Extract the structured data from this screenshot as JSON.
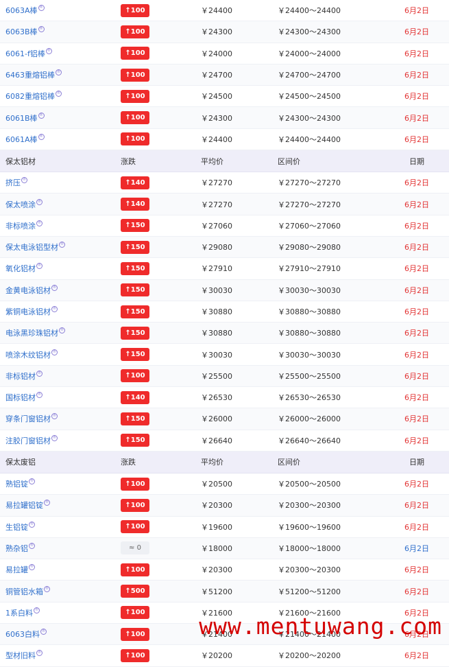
{
  "sections": [
    {
      "header": null,
      "rows": [
        {
          "name": "6063A棒",
          "change": "↑100",
          "avg": "￥24400",
          "range": "￥24400～24400",
          "date": "6月2日"
        },
        {
          "name": "6063B棒",
          "change": "↑100",
          "avg": "￥24300",
          "range": "￥24300～24300",
          "date": "6月2日"
        },
        {
          "name": "6061-f铝棒",
          "change": "↑100",
          "avg": "￥24000",
          "range": "￥24000～24000",
          "date": "6月2日"
        },
        {
          "name": "6463重熔铝棒",
          "change": "↑100",
          "avg": "￥24700",
          "range": "￥24700～24700",
          "date": "6月2日"
        },
        {
          "name": "6082重熔铝棒",
          "change": "↑100",
          "avg": "￥24500",
          "range": "￥24500～24500",
          "date": "6月2日"
        },
        {
          "name": "6061B棒",
          "change": "↑100",
          "avg": "￥24300",
          "range": "￥24300～24300",
          "date": "6月2日"
        },
        {
          "name": "6061A棒",
          "change": "↑100",
          "avg": "￥24400",
          "range": "￥24400～24400",
          "date": "6月2日"
        }
      ]
    },
    {
      "header": {
        "name": "保太铝材",
        "change": "涨跌",
        "avg": "平均价",
        "range": "区间价",
        "date": "日期"
      },
      "rows": [
        {
          "name": "挤压",
          "change": "↑140",
          "avg": "￥27270",
          "range": "￥27270～27270",
          "date": "6月2日"
        },
        {
          "name": "保太喷涂",
          "change": "↑140",
          "avg": "￥27270",
          "range": "￥27270～27270",
          "date": "6月2日"
        },
        {
          "name": "非标喷涂",
          "change": "↑150",
          "avg": "￥27060",
          "range": "￥27060～27060",
          "date": "6月2日"
        },
        {
          "name": "保太电泳铝型材",
          "change": "↑150",
          "avg": "￥29080",
          "range": "￥29080～29080",
          "date": "6月2日"
        },
        {
          "name": "氧化铝材",
          "change": "↑150",
          "avg": "￥27910",
          "range": "￥27910～27910",
          "date": "6月2日"
        },
        {
          "name": "金黄电泳铝材",
          "change": "↑150",
          "avg": "￥30030",
          "range": "￥30030～30030",
          "date": "6月2日"
        },
        {
          "name": "紫铜电泳铝材",
          "change": "↑150",
          "avg": "￥30880",
          "range": "￥30880～30880",
          "date": "6月2日"
        },
        {
          "name": "电泳黑珍珠铝材",
          "change": "↑150",
          "avg": "￥30880",
          "range": "￥30880～30880",
          "date": "6月2日"
        },
        {
          "name": "喷涂木纹铝材",
          "change": "↑150",
          "avg": "￥30030",
          "range": "￥30030～30030",
          "date": "6月2日"
        },
        {
          "name": "非标铝材",
          "change": "↑100",
          "avg": "￥25500",
          "range": "￥25500～25500",
          "date": "6月2日"
        },
        {
          "name": "国标铝材",
          "change": "↑140",
          "avg": "￥26530",
          "range": "￥26530～26530",
          "date": "6月2日"
        },
        {
          "name": "穿条门窗铝材",
          "change": "↑150",
          "avg": "￥26000",
          "range": "￥26000～26000",
          "date": "6月2日"
        },
        {
          "name": "注胶门窗铝材",
          "change": "↑150",
          "avg": "￥26640",
          "range": "￥26640～26640",
          "date": "6月2日"
        }
      ]
    },
    {
      "header": {
        "name": "保太废铝",
        "change": "涨跌",
        "avg": "平均价",
        "range": "区间价",
        "date": "日期"
      },
      "rows": [
        {
          "name": "熟铝锭",
          "change": "↑100",
          "avg": "￥20500",
          "range": "￥20500～20500",
          "date": "6月2日"
        },
        {
          "name": "易拉罐铝锭",
          "change": "↑100",
          "avg": "￥20300",
          "range": "￥20300～20300",
          "date": "6月2日"
        },
        {
          "name": "生铝锭",
          "change": "↑100",
          "avg": "￥19600",
          "range": "￥19600～19600",
          "date": "6月2日"
        },
        {
          "name": "熟杂铝",
          "change": "≈ 0",
          "avg": "￥18000",
          "range": "￥18000～18000",
          "date": "6月2日",
          "flat": true
        },
        {
          "name": "易拉罐",
          "change": "↑100",
          "avg": "￥20300",
          "range": "￥20300～20300",
          "date": "6月2日"
        },
        {
          "name": "铜管铝水箱",
          "change": "↑500",
          "avg": "￥51200",
          "range": "￥51200～51200",
          "date": "6月2日"
        },
        {
          "name": "1系白料",
          "change": "↑100",
          "avg": "￥21600",
          "range": "￥21600～21600",
          "date": "6月2日"
        },
        {
          "name": "6063白料",
          "change": "↑100",
          "avg": "￥21400",
          "range": "￥21400～21400",
          "date": "6月2日"
        },
        {
          "name": "型材旧料",
          "change": "↑100",
          "avg": "￥20200",
          "range": "￥20200～20200",
          "date": "6月2日"
        }
      ]
    }
  ],
  "watermark": "www.mentuwang.com"
}
